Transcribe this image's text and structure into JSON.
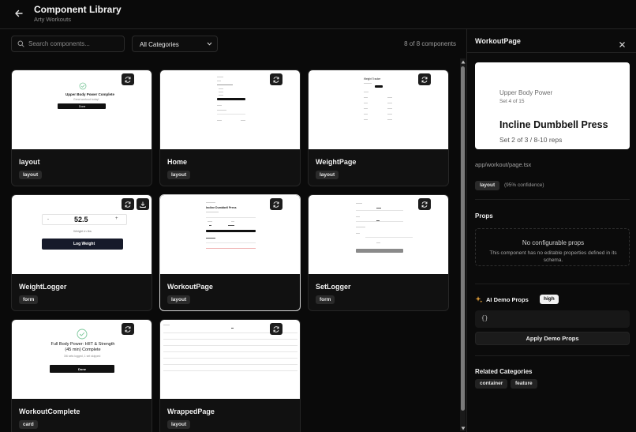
{
  "header": {
    "title": "Component Library",
    "subtitle": "Arty Workouts"
  },
  "toolbar": {
    "search_placeholder": "Search components...",
    "category_selected": "All Categories",
    "count_text": "8 of 8 components"
  },
  "cards": [
    {
      "name": "layout",
      "tag": "layout",
      "preview": {
        "title": "Upper Body Power Complete",
        "line": "Great workout today!",
        "button": "Done"
      }
    },
    {
      "name": "Home",
      "tag": "layout"
    },
    {
      "name": "WeightPage",
      "tag": "layout",
      "preview": {
        "header": "Weight Tracker"
      }
    },
    {
      "name": "WeightLogger",
      "tag": "form",
      "preview": {
        "minus": "-",
        "value": "52.5",
        "plus": "+",
        "unit": "Weight in lbs",
        "button": "Log Weight"
      }
    },
    {
      "name": "WorkoutPage",
      "tag": "layout",
      "preview": {
        "title": "Incline Dumbbell Press"
      }
    },
    {
      "name": "SetLogger",
      "tag": "form"
    },
    {
      "name": "WorkoutComplete",
      "tag": "card",
      "preview": {
        "title": "Full Body Power: HIIT & Strength (45 min) Complete",
        "line": "3/6 sets logged, 1 set skipped",
        "button": "Done"
      }
    },
    {
      "name": "WrappedPage",
      "tag": "layout"
    }
  ],
  "panel": {
    "title": "WorkoutPage",
    "preview": {
      "workout": "Upper Body Power",
      "set_progress": "Set 4 of 15",
      "exercise": "Incline Dumbbell Press",
      "meta": "Set 2 of 3 / 8-10 reps"
    },
    "file_path": "app/workout/page.tsx",
    "category_tag": "layout",
    "confidence": "(95% confidence)",
    "props_title": "Props",
    "props_empty_title": "No configurable props",
    "props_empty_desc": "This component has no editable properties defined in its schema.",
    "ai_title": "AI Demo Props",
    "ai_badge": "high",
    "ai_json": "{}",
    "apply_label": "Apply Demo Props",
    "related_title": "Related Categories",
    "related": [
      "container",
      "feature"
    ]
  },
  "colors": {
    "background": "#0a0a0a",
    "card": "#111111",
    "selected_border": "#d4d4d4",
    "tag_bg": "#2a2a2a"
  }
}
